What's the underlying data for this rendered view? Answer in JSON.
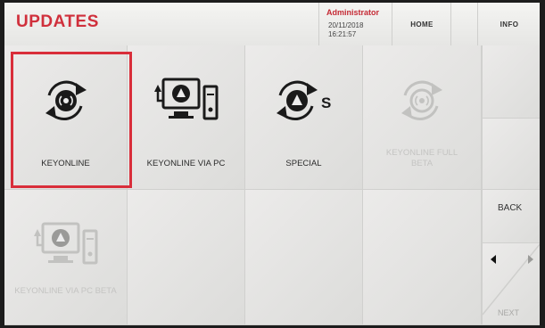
{
  "header": {
    "title": "UPDATES",
    "user": {
      "name": "Administrator",
      "date": "20/11/2018",
      "time": "16:21:57"
    },
    "buttons": {
      "home": "HOME",
      "info": "INFO"
    }
  },
  "tiles": [
    {
      "label": "KEYONLINE",
      "icon": "keyonline-sync-icon",
      "selected": true,
      "disabled": false
    },
    {
      "label": "KEYONLINE VIA PC",
      "icon": "pc-sync-icon",
      "selected": false,
      "disabled": false
    },
    {
      "label": "SPECIAL",
      "icon": "special-sync-icon",
      "selected": false,
      "disabled": false
    },
    {
      "label": "KEYONLINE FULL BETA",
      "icon": "keyonline-beta-sync-icon",
      "selected": false,
      "disabled": true
    },
    {
      "label": "KEYONLINE VIA PC BETA",
      "icon": "pc-beta-icon",
      "selected": false,
      "disabled": true
    }
  ],
  "nav": {
    "back": "BACK",
    "next": "NEXT"
  },
  "colors": {
    "accent": "#d92e3a",
    "title": "#d0303c"
  }
}
